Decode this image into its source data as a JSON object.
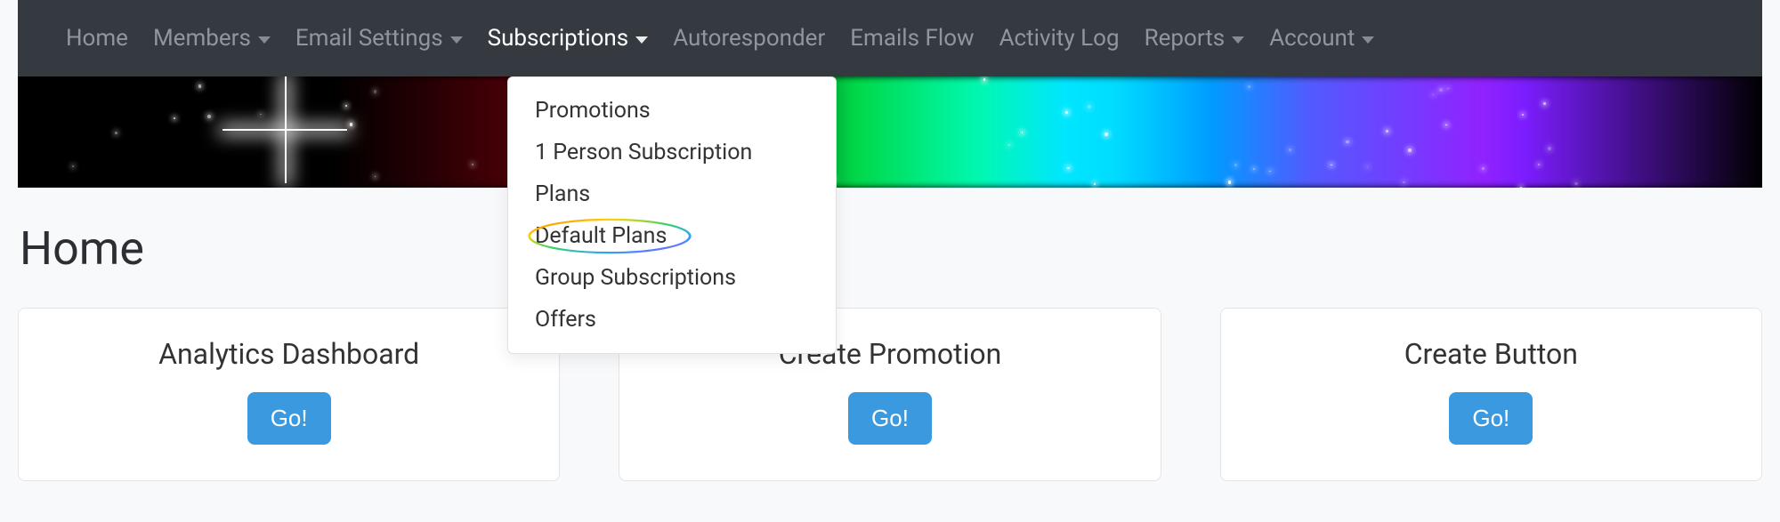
{
  "nav": {
    "items": [
      {
        "label": "Home",
        "has_caret": false,
        "active": false
      },
      {
        "label": "Members",
        "has_caret": true,
        "active": false
      },
      {
        "label": "Email Settings",
        "has_caret": true,
        "active": false
      },
      {
        "label": "Subscriptions",
        "has_caret": true,
        "active": true
      },
      {
        "label": "Autoresponder",
        "has_caret": false,
        "active": false
      },
      {
        "label": "Emails Flow",
        "has_caret": false,
        "active": false
      },
      {
        "label": "Activity Log",
        "has_caret": false,
        "active": false
      },
      {
        "label": "Reports",
        "has_caret": true,
        "active": false
      },
      {
        "label": "Account",
        "has_caret": true,
        "active": false
      }
    ]
  },
  "dropdown": {
    "items": [
      "Promotions",
      "1 Person Subscription",
      "Plans",
      "Default Plans",
      "Group Subscriptions",
      "Offers"
    ],
    "highlighted_index": 3
  },
  "page": {
    "title": "Home",
    "cards": [
      {
        "title": "Analytics Dashboard",
        "button": "Go!"
      },
      {
        "title": "Create Promotion",
        "button": "Go!"
      },
      {
        "title": "Create Button",
        "button": "Go!"
      }
    ]
  },
  "colors": {
    "nav_bg": "#343a40",
    "nav_text": "#8f969d",
    "nav_active": "#ffffff",
    "button_bg": "#3b99e0"
  }
}
